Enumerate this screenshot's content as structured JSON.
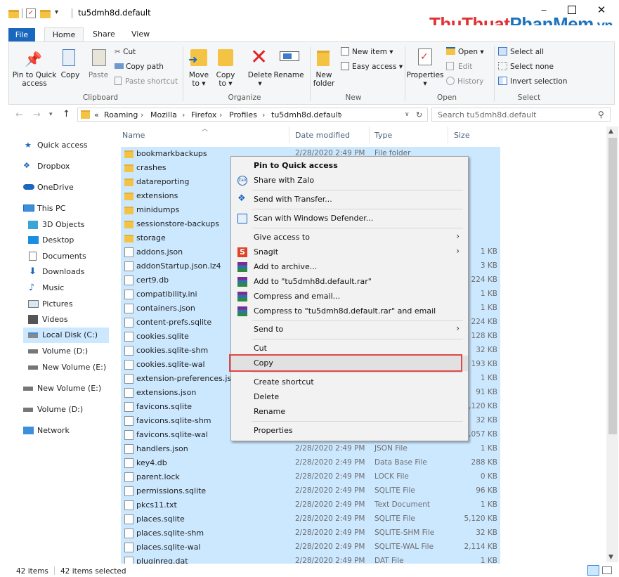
{
  "window": {
    "title": "tu5dmh8d.default"
  },
  "watermark": {
    "part1": "Thu",
    "part2": "Thuat",
    "part3": "Phan",
    "part4": "Mem",
    "part5": ".vn"
  },
  "tabs": [
    {
      "label": "File"
    },
    {
      "label": "Home"
    },
    {
      "label": "Share"
    },
    {
      "label": "View"
    }
  ],
  "ribbon": {
    "clipboard": {
      "pin": "Pin to Quick access",
      "copy": "Copy",
      "paste": "Paste",
      "cut": "Cut",
      "copy_path": "Copy path",
      "paste_shortcut": "Paste shortcut",
      "group": "Clipboard"
    },
    "organize": {
      "move_to": "Move to",
      "copy_to": "Copy to",
      "delete": "Delete",
      "rename": "Rename",
      "group": "Organize"
    },
    "new": {
      "new_folder": "New folder",
      "new_item": "New item",
      "easy_access": "Easy access",
      "group": "New"
    },
    "open": {
      "properties": "Properties",
      "open": "Open",
      "edit": "Edit",
      "history": "History",
      "group": "Open"
    },
    "select": {
      "select_all": "Select all",
      "select_none": "Select none",
      "invert": "Invert selection",
      "group": "Select"
    }
  },
  "address": {
    "overflow": "«",
    "crumbs": [
      "Roaming",
      "Mozilla",
      "Firefox",
      "Profiles",
      "tu5dmh8d.default"
    ],
    "search_placeholder": "Search tu5dmh8d.default"
  },
  "nav": {
    "quick_access": "Quick access",
    "dropbox": "Dropbox",
    "onedrive": "OneDrive",
    "this_pc": "This PC",
    "objects3d": "3D Objects",
    "desktop": "Desktop",
    "documents": "Documents",
    "downloads": "Downloads",
    "music": "Music",
    "pictures": "Pictures",
    "videos": "Videos",
    "local_disk": "Local Disk (C:)",
    "volume_d": "Volume (D:)",
    "new_volume_e": "New Volume (E:)",
    "new_volume_e2": "New Volume (E:)",
    "volume_d2": "Volume (D:)",
    "network": "Network"
  },
  "columns": {
    "name": "Name",
    "date": "Date modified",
    "type": "Type",
    "size": "Size"
  },
  "files": [
    {
      "name": "bookmarkbackups",
      "date": "2/28/2020 2:49 PM",
      "type": "File folder",
      "size": "",
      "icon": "folder"
    },
    {
      "name": "crashes",
      "date": "",
      "type": "",
      "size": "",
      "icon": "folder"
    },
    {
      "name": "datareporting",
      "date": "",
      "type": "",
      "size": "",
      "icon": "folder"
    },
    {
      "name": "extensions",
      "date": "",
      "type": "",
      "size": "",
      "icon": "folder"
    },
    {
      "name": "minidumps",
      "date": "",
      "type": "",
      "size": "",
      "icon": "folder"
    },
    {
      "name": "sessionstore-backups",
      "date": "",
      "type": "",
      "size": "",
      "icon": "folder"
    },
    {
      "name": "storage",
      "date": "",
      "type": "",
      "size": "",
      "icon": "folder"
    },
    {
      "name": "addons.json",
      "date": "",
      "type": "",
      "size": "1 KB",
      "icon": "doc"
    },
    {
      "name": "addonStartup.json.lz4",
      "date": "",
      "type": "",
      "size": "3 KB",
      "icon": "doc"
    },
    {
      "name": "cert9.db",
      "date": "",
      "type": "",
      "size": "224 KB",
      "icon": "db"
    },
    {
      "name": "compatibility.ini",
      "date": "",
      "type": "",
      "size": "1 KB",
      "icon": "ini"
    },
    {
      "name": "containers.json",
      "date": "",
      "type": "",
      "size": "1 KB",
      "icon": "doc"
    },
    {
      "name": "content-prefs.sqlite",
      "date": "",
      "type": "",
      "size": "224 KB",
      "icon": "doc"
    },
    {
      "name": "cookies.sqlite",
      "date": "",
      "type": "",
      "size": "128 KB",
      "icon": "doc"
    },
    {
      "name": "cookies.sqlite-shm",
      "date": "",
      "type": "",
      "size": "32 KB",
      "icon": "doc"
    },
    {
      "name": "cookies.sqlite-wal",
      "date": "",
      "type": "",
      "size": "193 KB",
      "icon": "doc"
    },
    {
      "name": "extension-preferences.json",
      "date": "",
      "type": "",
      "size": "1 KB",
      "icon": "doc"
    },
    {
      "name": "extensions.json",
      "date": "",
      "type": "",
      "size": "91 KB",
      "icon": "doc"
    },
    {
      "name": "favicons.sqlite",
      "date": "",
      "type": "",
      "size": "5,120 KB",
      "icon": "doc"
    },
    {
      "name": "favicons.sqlite-shm",
      "date": "",
      "type": "",
      "size": "32 KB",
      "icon": "doc"
    },
    {
      "name": "favicons.sqlite-wal",
      "date": "",
      "type": "",
      "size": "1,057 KB",
      "icon": "doc"
    },
    {
      "name": "handlers.json",
      "date": "2/28/2020 2:49 PM",
      "type": "JSON File",
      "size": "1 KB",
      "icon": "doc"
    },
    {
      "name": "key4.db",
      "date": "2/28/2020 2:49 PM",
      "type": "Data Base File",
      "size": "288 KB",
      "icon": "db"
    },
    {
      "name": "parent.lock",
      "date": "2/28/2020 2:49 PM",
      "type": "LOCK File",
      "size": "0 KB",
      "icon": "doc"
    },
    {
      "name": "permissions.sqlite",
      "date": "2/28/2020 2:49 PM",
      "type": "SQLITE File",
      "size": "96 KB",
      "icon": "doc"
    },
    {
      "name": "pkcs11.txt",
      "date": "2/28/2020 2:49 PM",
      "type": "Text Document",
      "size": "1 KB",
      "icon": "txt"
    },
    {
      "name": "places.sqlite",
      "date": "2/28/2020 2:49 PM",
      "type": "SQLITE File",
      "size": "5,120 KB",
      "icon": "doc"
    },
    {
      "name": "places.sqlite-shm",
      "date": "2/28/2020 2:49 PM",
      "type": "SQLITE-SHM File",
      "size": "32 KB",
      "icon": "doc"
    },
    {
      "name": "places.sqlite-wal",
      "date": "2/28/2020 2:49 PM",
      "type": "SQLITE-WAL File",
      "size": "2,114 KB",
      "icon": "doc"
    },
    {
      "name": "pluginreg.dat",
      "date": "2/28/2020 2:49 PM",
      "type": "DAT File",
      "size": "1 KB",
      "icon": "doc"
    }
  ],
  "menu": {
    "pin": "Pin to Quick access",
    "zalo": "Share with Zalo",
    "transfer": "Send with Transfer...",
    "defender": "Scan with Windows Defender...",
    "give_access": "Give access to",
    "snagit": "Snagit",
    "add_archive": "Add to archive...",
    "add_rar": "Add to \"tu5dmh8d.default.rar\"",
    "compress_email": "Compress and email...",
    "compress_rar_email": "Compress to \"tu5dmh8d.default.rar\" and email",
    "send_to": "Send to",
    "cut": "Cut",
    "copy": "Copy",
    "create_shortcut": "Create shortcut",
    "delete": "Delete",
    "rename": "Rename",
    "properties": "Properties"
  },
  "status": {
    "items": "42 items",
    "selected": "42 items selected"
  },
  "colors": {
    "accent": "#1a68bd",
    "selection": "#cce8ff",
    "highlight": "#e04646"
  }
}
